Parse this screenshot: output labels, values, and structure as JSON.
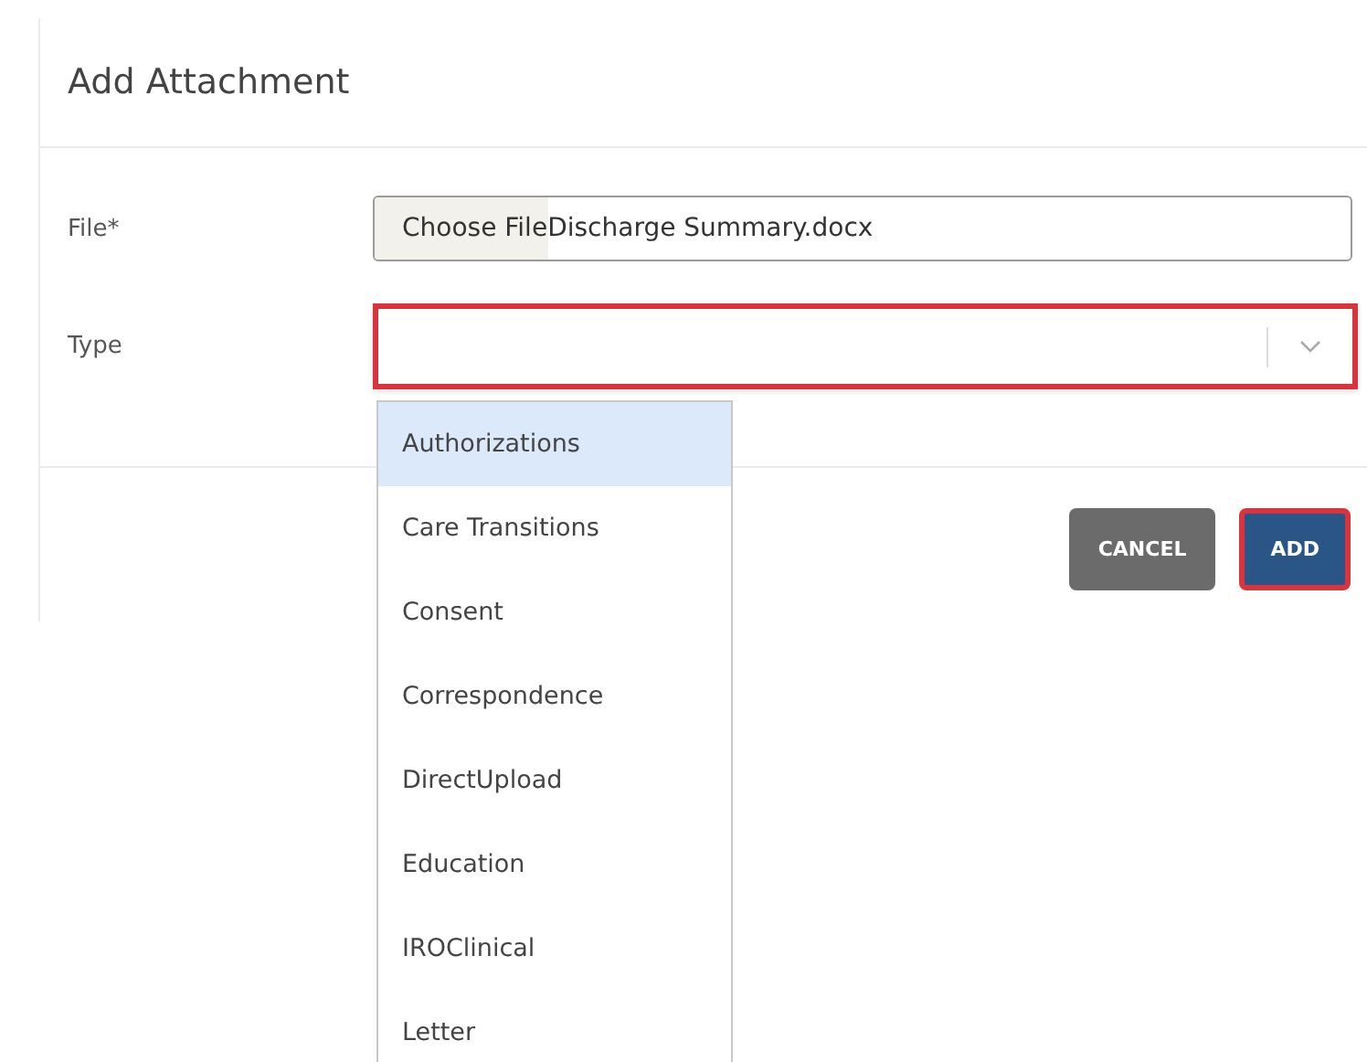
{
  "dialog": {
    "title": "Add Attachment"
  },
  "fields": [
    {
      "kind": "file",
      "label": "File*",
      "button": "Choose File",
      "value": "Discharge Summary.docx",
      "highlighted": false
    },
    {
      "kind": "select",
      "label": "Type",
      "highlighted": true,
      "expanded": true,
      "options": [
        {
          "label": "Authorizations",
          "selected": true
        },
        {
          "label": "Care Transitions",
          "selected": false
        },
        {
          "label": "Consent",
          "selected": false
        },
        {
          "label": "Correspondence",
          "selected": false
        },
        {
          "label": "DirectUpload",
          "selected": false
        },
        {
          "label": "Education",
          "selected": false
        },
        {
          "label": "IROClinical",
          "selected": false
        },
        {
          "label": "Letter",
          "selected": false
        }
      ]
    }
  ],
  "buttons": [
    {
      "label": "CANCEL",
      "kind": "secondary",
      "highlighted": false
    },
    {
      "label": "ADD",
      "kind": "primary",
      "highlighted": true
    }
  ]
}
